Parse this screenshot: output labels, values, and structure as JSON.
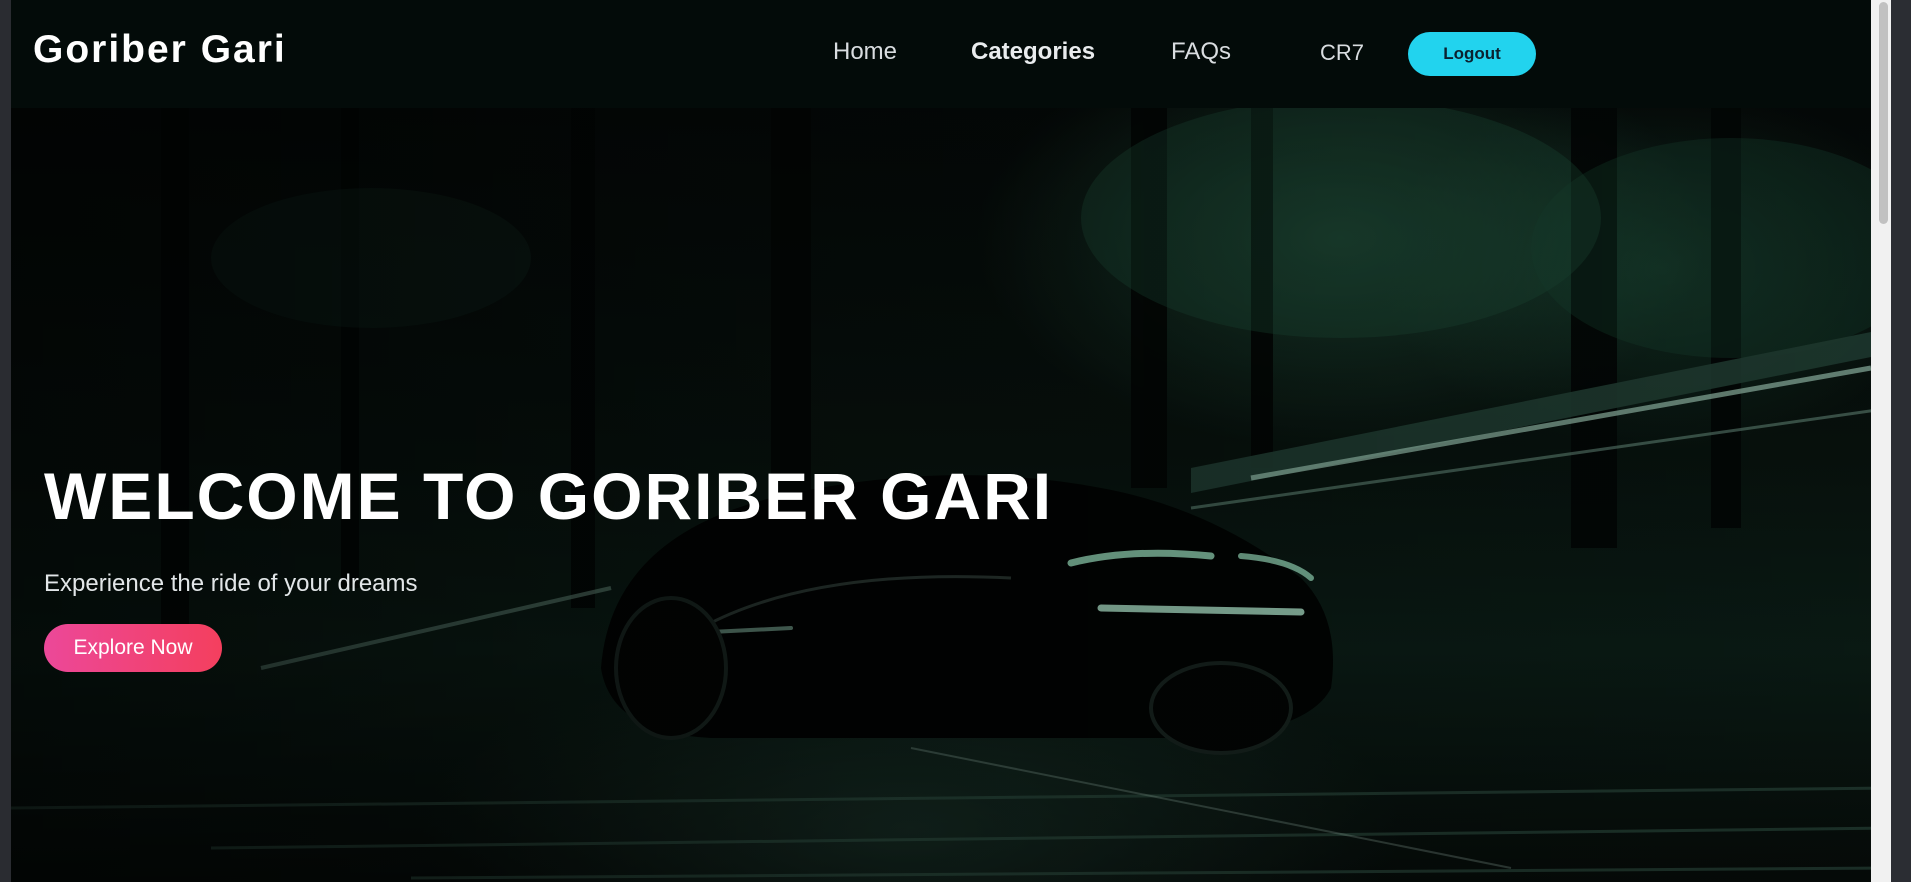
{
  "navbar": {
    "brand": "Goriber Gari",
    "links": {
      "home": "Home",
      "categories": "Categories",
      "faqs": "FAQs"
    },
    "user": "CR7",
    "logout_label": "Logout",
    "colors": {
      "logout_bg": "#22d3ee"
    }
  },
  "hero": {
    "title": "WELCOME TO GORIBER GARI",
    "subtitle": "Experience the ride of your dreams",
    "cta_label": "Explore Now",
    "colors": {
      "cta_start": "#ec4899",
      "cta_end": "#f43f5e"
    }
  }
}
